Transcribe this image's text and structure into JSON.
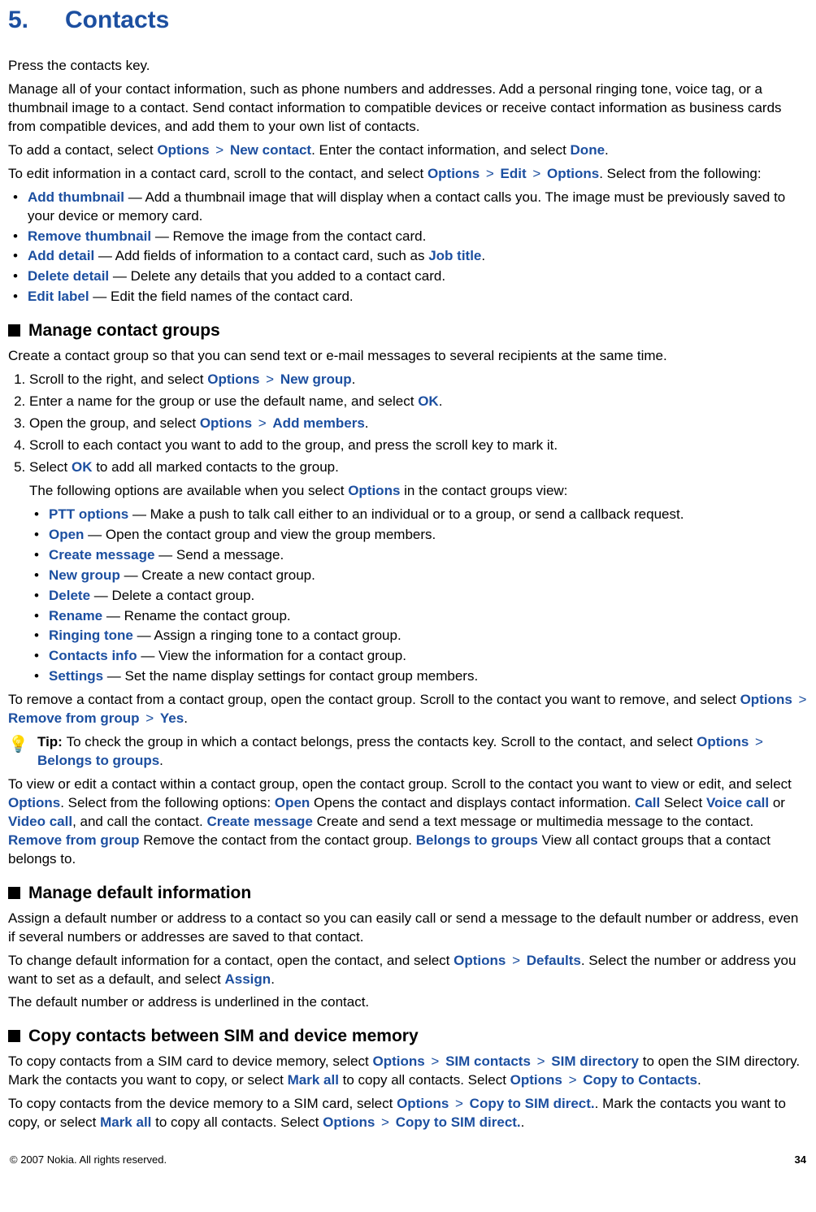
{
  "chapter": {
    "num": "5.",
    "title": "Contacts"
  },
  "p_press": "Press the contacts key.",
  "p_manage": "Manage all of your contact information, such as phone numbers and addresses. Add a personal ringing tone, voice tag, or a thumbnail image to a contact. Send contact information to compatible devices or receive contact information as business cards from compatible devices, and add them to your own list of contacts.",
  "add_contact": {
    "pre": "To add a contact, select ",
    "opt": "Options",
    "gt": " > ",
    "newc": "New contact",
    "mid": ". Enter the contact information, and select ",
    "done": "Done",
    "post": "."
  },
  "edit_contact": {
    "pre": "To edit information in a contact card, scroll to the contact, and select ",
    "opt1": "Options",
    "gt": " > ",
    "edit": "Edit",
    "opt2": "Options",
    "post": ". Select from the following:"
  },
  "edit_opts": {
    "add_thumb_k": "Add thumbnail",
    "add_thumb_v": " — Add a thumbnail image that will display when a contact calls you. The image must be previously saved to your device or memory card.",
    "rem_thumb_k": "Remove thumbnail",
    "rem_thumb_v": " — Remove the image from the contact card.",
    "add_detail_k": "Add detail",
    "add_detail_v1": " — Add fields of information to a contact card, such as ",
    "add_detail_jt": "Job title",
    "add_detail_v2": ".",
    "del_detail_k": "Delete detail",
    "del_detail_v": " — Delete any details that you added to a contact card.",
    "edit_label_k": "Edit label",
    "edit_label_v": " — Edit the field names of the contact card."
  },
  "h2_groups": "Manage contact groups",
  "groups_intro": "Create a contact group so that you can send text or e-mail messages to several recipients at the same time.",
  "steps": {
    "s1_pre": "Scroll to the right, and select ",
    "s1_opt": "Options",
    "gt": " > ",
    "s1_new": "New group",
    "s1_post": ".",
    "s2_pre": "Enter a name for the group or use the default name, and select ",
    "s2_ok": "OK",
    "s2_post": ".",
    "s3_pre": "Open the group, and select ",
    "s3_opt": "Options",
    "s3_add": "Add members",
    "s3_post": ".",
    "s4": "Scroll to each contact you want to add to the group, and press the scroll key to mark it.",
    "s5_pre": "Select ",
    "s5_ok": "OK",
    "s5_post": " to add all marked contacts to the group."
  },
  "options_intro_pre": "The following options are available when you select ",
  "options_intro_opt": "Options",
  "options_intro_post": " in the contact groups view:",
  "grp_opts": {
    "ptt_k": "PTT options",
    "ptt_v": " — Make a push to talk call either to an individual or to a group, or send a callback request.",
    "open_k": "Open",
    "open_v": " — Open the contact group and view the group members.",
    "cmsg_k": "Create message",
    "cmsg_v": " — Send a message.",
    "ng_k": "New group",
    "ng_v": " — Create a new contact group.",
    "del_k": "Delete",
    "del_v": " — Delete a contact group.",
    "ren_k": "Rename",
    "ren_v": " — Rename the contact group.",
    "ring_k": "Ringing tone",
    "ring_v": " — Assign a ringing tone to a contact group.",
    "info_k": "Contacts info",
    "info_v": " — View the information for a contact group.",
    "set_k": "Settings",
    "set_v": " — Set the name display settings for contact group members."
  },
  "remove": {
    "pre": "To remove a contact from a contact group, open the contact group. Scroll to the contact you want to remove, and select ",
    "opt": "Options",
    "gt": " > ",
    "rfg": "Remove from group",
    "yes": "Yes",
    "post": "."
  },
  "tip": {
    "label": "Tip: ",
    "txt1": "To check the group in which a contact belongs, press the contacts key. Scroll to the contact, and select ",
    "opt": "Options",
    "gt": " > ",
    "btg": "Belongs to groups",
    "post": "."
  },
  "view_edit": {
    "t1": "To view or edit a contact within a contact group, open the contact group. Scroll to the contact you want to view or edit, and select ",
    "opt": "Options",
    "t2": ". Select from the following options: ",
    "open": "Open",
    "t3": " Opens the contact and displays contact information. ",
    "call": "Call",
    "t4": " Select ",
    "voice": "Voice call",
    "t5": " or ",
    "video": "Video call",
    "t6": ", and call the contact. ",
    "cmsg": "Create message",
    "t7": " Create and send a text message or multimedia message to the contact. ",
    "rfg": "Remove from group",
    "t8": " Remove the contact from the contact group. ",
    "btg": "Belongs to groups",
    "t9": " View all contact groups that a contact belongs to."
  },
  "h2_default": "Manage default information",
  "def_p1": "Assign a default number or address to a contact so you can easily call or send a message to the default number or address, even if several numbers or addresses are saved to that contact.",
  "def_change": {
    "pre": "To change default information for a contact, open the contact, and select ",
    "opt": "Options",
    "gt": " > ",
    "defaults": "Defaults",
    "mid": ". Select the number or address you want to set as a default, and select ",
    "assign": "Assign",
    "post": "."
  },
  "def_underline": "The default number or address is underlined in the contact.",
  "h2_copy": "Copy contacts between SIM and device memory",
  "copy1": {
    "pre": "To copy contacts from a SIM card to device memory, select ",
    "opt1": "Options",
    "gt": " > ",
    "simc": "SIM contacts",
    "simd": "SIM directory",
    "mid1": " to open the SIM directory. Mark the contacts you want to copy, or select ",
    "markall": "Mark all",
    "mid2": " to copy all contacts. Select ",
    "opt2": "Options",
    "copyto": "Copy to Contacts",
    "post": "."
  },
  "copy2": {
    "pre": "To copy contacts from the device memory to a SIM card, select ",
    "opt1": "Options",
    "gt": " > ",
    "ctsd": "Copy to SIM direct.",
    "mid1": ". Mark the contacts you want to copy, or select ",
    "markall": "Mark all",
    "mid2": " to copy all contacts. Select ",
    "opt2": "Options",
    "post": "."
  },
  "footer": {
    "copyright": "© 2007 Nokia. All rights reserved.",
    "page": "34"
  }
}
